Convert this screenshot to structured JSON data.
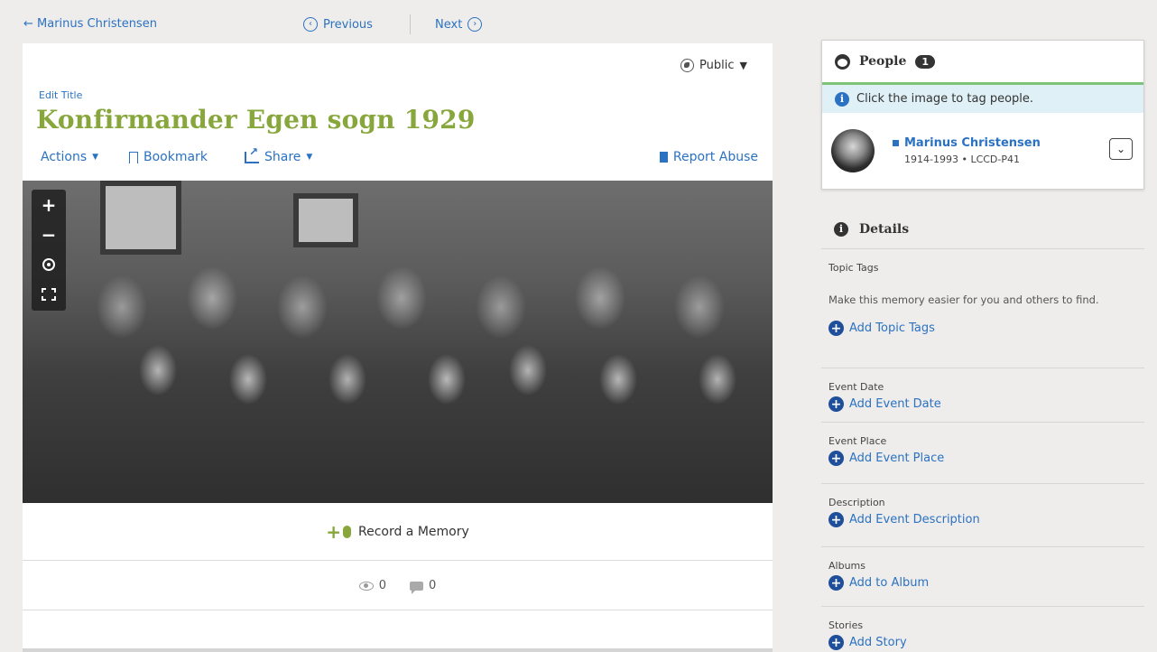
{
  "nav": {
    "back_label": "← Marinus Christensen",
    "previous_label": "Previous",
    "next_label": "Next"
  },
  "memory": {
    "visibility": "Public",
    "edit_title_label": "Edit Title",
    "title": "Konfirmander Egen sogn 1929",
    "actions_label": "Actions",
    "bookmark_label": "Bookmark",
    "share_label": "Share",
    "report_label": "Report Abuse",
    "record_label": "Record a Memory",
    "views": "0",
    "comments": "0"
  },
  "viewer": {
    "zoom_in": "+",
    "zoom_out": "−"
  },
  "people": {
    "heading": "People",
    "count": "1",
    "hint": "Click the image to tag people.",
    "person": {
      "name": "Marinus Christensen",
      "meta": "1914-1993 • LCCD-P41"
    }
  },
  "details": {
    "heading": "Details",
    "topic_tags": {
      "label": "Topic Tags",
      "description": "Make this memory easier for you and others to find.",
      "add_label": "Add Topic Tags"
    },
    "event_date": {
      "label": "Event Date",
      "add_label": "Add Event Date"
    },
    "event_place": {
      "label": "Event Place",
      "add_label": "Add Event Place"
    },
    "description": {
      "label": "Description",
      "add_label": "Add Event Description"
    },
    "albums": {
      "label": "Albums",
      "add_label": "Add to Album"
    },
    "stories": {
      "label": "Stories",
      "add_label": "Add Story"
    }
  },
  "colors": {
    "link": "#2b72c2",
    "title_green": "#87a73c",
    "hint_bg": "#dff0f6",
    "hint_border": "#7fc37a",
    "page_bg": "#eeedeb"
  },
  "icons": [
    "back-arrow-icon",
    "previous-icon",
    "next-icon",
    "globe-icon",
    "caret-down-icon",
    "bookmark-icon",
    "share-icon",
    "flag-icon",
    "zoom-in-icon",
    "zoom-out-icon",
    "recenter-icon",
    "fullscreen-icon",
    "record-memory-icon",
    "eye-icon",
    "comment-icon",
    "face-icon",
    "info-icon",
    "chevron-down-icon",
    "plus-circle-icon"
  ]
}
